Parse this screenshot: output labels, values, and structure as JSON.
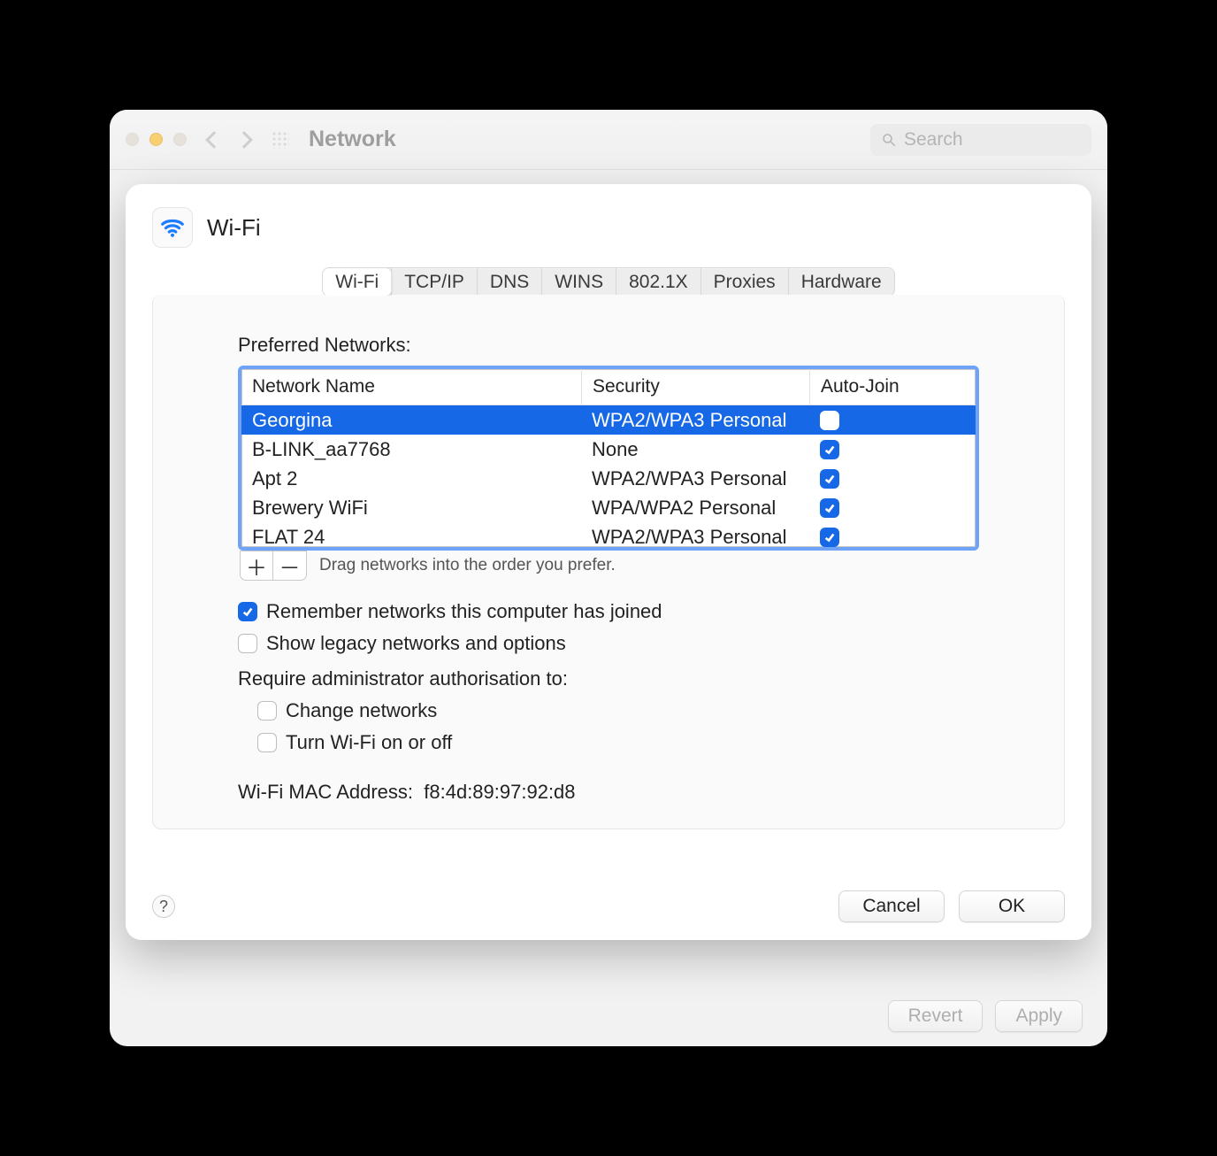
{
  "window": {
    "title": "Network",
    "search_placeholder": "Search",
    "back_buttons": {
      "revert": "Revert",
      "apply": "Apply"
    }
  },
  "sheet": {
    "title": "Wi-Fi",
    "tabs": [
      "Wi-Fi",
      "TCP/IP",
      "DNS",
      "WINS",
      "802.1X",
      "Proxies",
      "Hardware"
    ],
    "active_tab": 0,
    "preferred_label": "Preferred Networks:",
    "columns": {
      "name": "Network Name",
      "security": "Security",
      "autojoin": "Auto-Join"
    },
    "networks": [
      {
        "name": "Georgina",
        "security": "WPA2/WPA3 Personal",
        "autojoin": false,
        "selected": true
      },
      {
        "name": "B-LINK_aa7768",
        "security": "None",
        "autojoin": true,
        "selected": false
      },
      {
        "name": "Apt 2",
        "security": "WPA2/WPA3 Personal",
        "autojoin": true,
        "selected": false
      },
      {
        "name": "Brewery WiFi",
        "security": "WPA/WPA2 Personal",
        "autojoin": true,
        "selected": false
      },
      {
        "name": "FLAT 24",
        "security": "WPA2/WPA3 Personal",
        "autojoin": true,
        "selected": false
      }
    ],
    "drag_hint": "Drag networks into the order you prefer.",
    "options": {
      "remember": {
        "label": "Remember networks this computer has joined",
        "checked": true
      },
      "legacy": {
        "label": "Show legacy networks and options",
        "checked": false
      },
      "admin_label": "Require administrator authorisation to:",
      "change": {
        "label": "Change networks",
        "checked": false
      },
      "toggle": {
        "label": "Turn Wi-Fi on or off",
        "checked": false
      }
    },
    "mac_label": "Wi-Fi MAC Address:",
    "mac_value": "f8:4d:89:97:92:d8",
    "buttons": {
      "cancel": "Cancel",
      "ok": "OK"
    }
  }
}
